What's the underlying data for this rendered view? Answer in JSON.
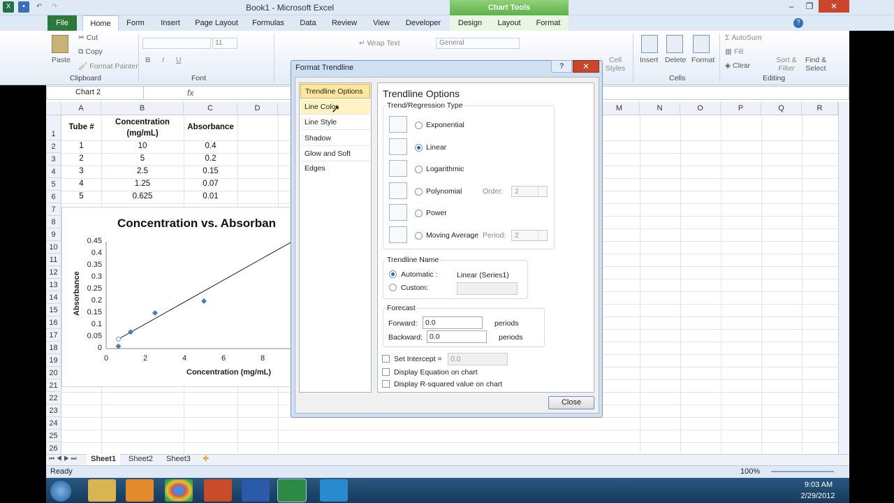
{
  "window": {
    "title": "Book1 - Microsoft Excel",
    "context_tab": "Chart Tools"
  },
  "tabs": [
    "File",
    "Home",
    "Form",
    "Insert",
    "Page Layout",
    "Formulas",
    "Data",
    "Review",
    "View",
    "Developer",
    "Design",
    "Layout",
    "Format"
  ],
  "ribbon": {
    "clipboard": {
      "paste": "Paste",
      "cut": "Cut",
      "copy": "Copy",
      "format_painter": "Format Painter",
      "label": "Clipboard"
    },
    "font": {
      "label": "Font",
      "size": "11"
    },
    "alignment": {
      "wrap_text": "Wrap Text"
    },
    "number": {
      "format": "General"
    },
    "styles": {
      "cell_styles": "Cell Styles"
    },
    "cells": {
      "insert": "Insert",
      "delete": "Delete",
      "format": "Format",
      "label": "Cells"
    },
    "editing": {
      "autosum": "AutoSum",
      "fill": "Fill",
      "clear": "Clear",
      "sort": "Sort & Filter",
      "find": "Find & Select",
      "label": "Editing"
    }
  },
  "name_box": "Chart 2",
  "fx": "fx",
  "columns": [
    "A",
    "B",
    "C",
    "D",
    "M",
    "N",
    "O",
    "P",
    "Q",
    "R"
  ],
  "rows": [
    "1",
    "2",
    "3",
    "4",
    "5",
    "6",
    "7",
    "8",
    "9",
    "10",
    "11",
    "12",
    "13",
    "14",
    "15",
    "16",
    "17",
    "18",
    "19",
    "20",
    "21",
    "22",
    "23",
    "24",
    "25",
    "26"
  ],
  "table": {
    "headers": [
      "Tube #",
      "Concentration (mg/mL)",
      "Absorbance"
    ],
    "rows": [
      [
        "1",
        "10",
        "0.4"
      ],
      [
        "2",
        "5",
        "0.2"
      ],
      [
        "3",
        "2.5",
        "0.15"
      ],
      [
        "4",
        "1.25",
        "0.07"
      ],
      [
        "5",
        "0.625",
        "0.01"
      ]
    ]
  },
  "chart_data": {
    "type": "scatter",
    "title": "Concentration vs. Absorban",
    "xlabel": "Concentration (mg/mL)",
    "ylabel": "Absorbance",
    "x_ticks": [
      "0",
      "2",
      "4",
      "6",
      "8"
    ],
    "y_ticks": [
      "0",
      "0.05",
      "0.1",
      "0.15",
      "0.2",
      "0.25",
      "0.3",
      "0.35",
      "0.4",
      "0.45"
    ],
    "xlim": [
      0,
      9.5
    ],
    "ylim": [
      0,
      0.45
    ],
    "grid": false,
    "points": [
      {
        "x": 0.625,
        "y": 0.01
      },
      {
        "x": 1.25,
        "y": 0.07
      },
      {
        "x": 2.5,
        "y": 0.15
      },
      {
        "x": 5,
        "y": 0.2
      }
    ],
    "trendline": {
      "x": [
        0.625,
        9.5
      ],
      "y": [
        0.04,
        0.45
      ]
    },
    "colors": {
      "marker": "#4a7db8",
      "line": "#222222"
    }
  },
  "dialog": {
    "title": "Format Trendline",
    "help": "?",
    "close_x": "✕",
    "nav": [
      "Trendline Options",
      "Line Color",
      "Line Style",
      "Shadow",
      "Glow and Soft Edges"
    ],
    "heading": "Trendline Options",
    "trend_group": "Trend/Regression Type",
    "types": [
      "Exponential",
      "Linear",
      "Logarithmic",
      "Polynomial",
      "Power",
      "Moving Average"
    ],
    "selected_type": "Linear",
    "order_label": "Order:",
    "order_value": "2",
    "period_label": "Period:",
    "period_value": "2",
    "name_group": "Trendline Name",
    "automatic_label": "Automatic :",
    "automatic_value": "Linear (Series1)",
    "custom_label": "Custom:",
    "forecast_group": "Forecast",
    "forward_label": "Forward:",
    "forward_value": "0.0",
    "backward_label": "Backward:",
    "backward_value": "0.0",
    "periods": "periods",
    "set_intercept": "Set Intercept =",
    "intercept_value": "0.0",
    "display_equation": "Display Equation on chart",
    "display_rsq": "Display R-squared value on chart",
    "close_button": "Close"
  },
  "sheets": [
    "Sheet1",
    "Sheet2",
    "Sheet3"
  ],
  "status": {
    "ready": "Ready",
    "zoom": "100%"
  },
  "clock": {
    "time": "9:03 AM",
    "date": "2/29/2012"
  }
}
